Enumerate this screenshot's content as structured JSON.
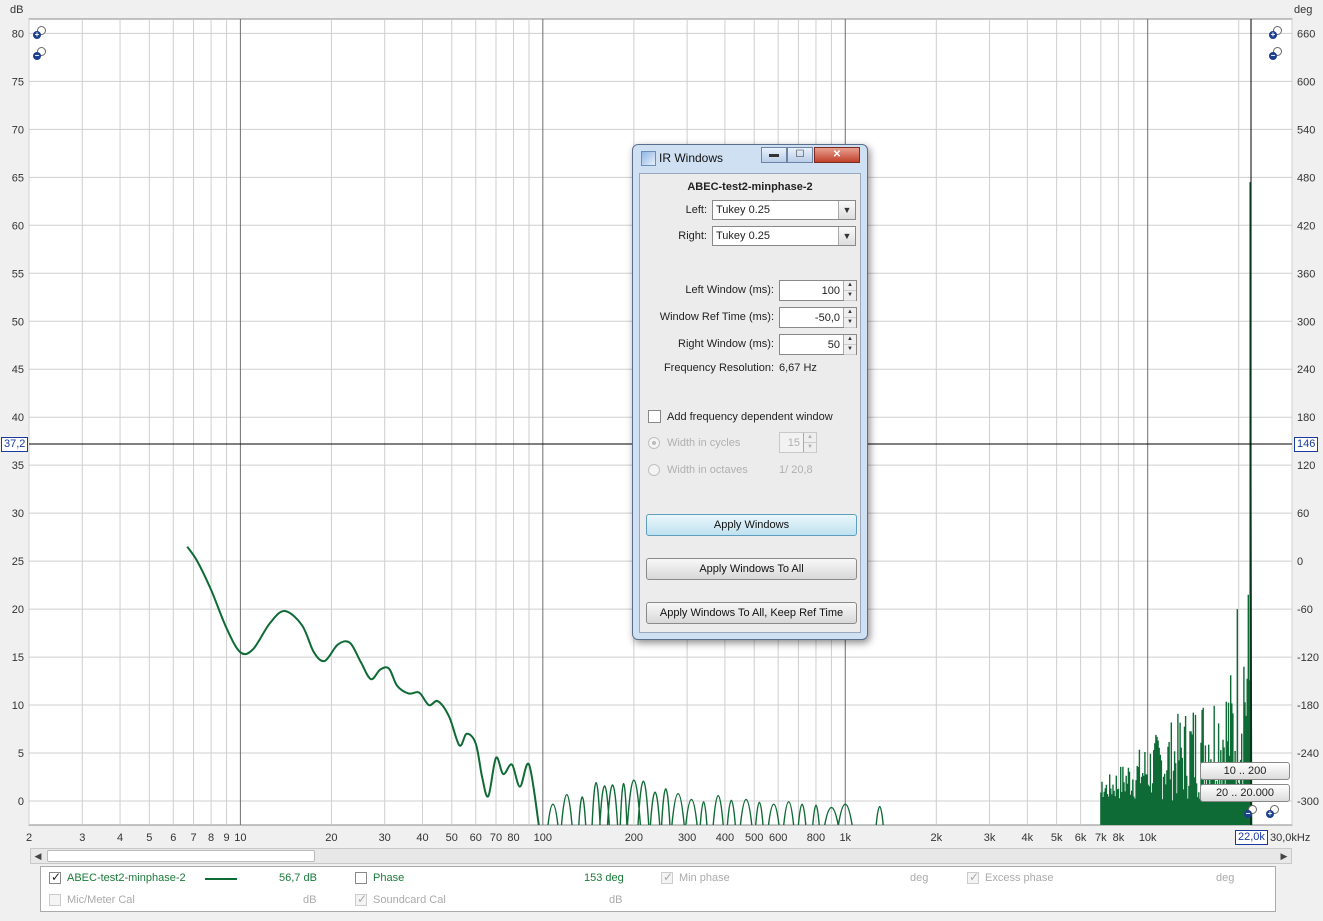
{
  "axes": {
    "left_unit": "dB",
    "right_unit": "deg",
    "left_ticks": [
      "80",
      "75",
      "70",
      "65",
      "60",
      "55",
      "50",
      "45",
      "40",
      "35",
      "30",
      "25",
      "20",
      "15",
      "10",
      "5",
      "0"
    ],
    "right_ticks": [
      "660",
      "600",
      "540",
      "480",
      "420",
      "360",
      "300",
      "240",
      "180",
      "120",
      "60",
      "0",
      "-60",
      "-120",
      "-180",
      "-240",
      "-300"
    ],
    "x_ticks": [
      "2",
      "3",
      "4",
      "5",
      "6",
      "7",
      "8",
      "9",
      "10",
      "20",
      "30",
      "40",
      "50",
      "60",
      "70",
      "80",
      "100",
      "200",
      "300",
      "400",
      "500",
      "600",
      "800",
      "1k",
      "2k",
      "3k",
      "4k",
      "5k",
      "6k",
      "7k",
      "8k",
      "10k",
      "30,0kHz"
    ]
  },
  "cursor": {
    "left_value": "37,2",
    "right_value": "146",
    "x_value": "22,0k"
  },
  "range_buttons": {
    "top": "10 .. 200",
    "bottom": "20 .. 20.000"
  },
  "chart_data": {
    "type": "line",
    "x_scale": "log",
    "xlim": [
      2,
      30000
    ],
    "ylim": [
      -2.5,
      81.5
    ],
    "ylabel": "dB",
    "y2label": "deg",
    "y2lim": [
      -330,
      678
    ],
    "grid": true,
    "series": [
      {
        "name": "ABEC-test2-minphase-2",
        "color": "#0f6b35",
        "x": [
          6.67,
          7.2,
          8,
          9,
          10,
          11,
          12.5,
          14,
          16,
          17.5,
          19,
          21,
          23,
          25,
          27,
          29,
          31,
          33,
          36,
          39,
          42,
          45,
          49,
          53,
          56,
          60,
          63,
          66,
          70,
          74,
          79,
          84,
          90,
          97
        ],
        "y": [
          26.5,
          25,
          22,
          18,
          15.5,
          15.8,
          18.5,
          19.8,
          18.3,
          15.5,
          14.6,
          16.3,
          16.5,
          14.5,
          12.7,
          13.7,
          13.8,
          12,
          11.2,
          11.3,
          10,
          10.4,
          8.8,
          5.8,
          7,
          6,
          2.5,
          0.5,
          4.5,
          2.8,
          3.8,
          1.5,
          3.8,
          -2.5
        ]
      }
    ]
  },
  "dialog": {
    "title": "IR Windows",
    "measurement": "ABEC-test2-minphase-2",
    "left_label": "Left:",
    "left_value": "Tukey 0.25",
    "right_label": "Right:",
    "right_value": "Tukey 0.25",
    "left_window_label": "Left Window (ms):",
    "left_window_value": "100",
    "ref_time_label": "Window Ref Time (ms):",
    "ref_time_value": "-50,0",
    "right_window_label": "Right Window (ms):",
    "right_window_value": "50",
    "freq_res_label": "Frequency Resolution:",
    "freq_res_value": "6,67 Hz",
    "freq_dep_label": "Add frequency dependent window",
    "width_cycles_label": "Width in cycles",
    "width_cycles_value": "15",
    "width_octaves_label": "Width in octaves",
    "width_octaves_value": "1/ 20,8",
    "apply_label": "Apply Windows",
    "apply_all_label": "Apply Windows To All",
    "apply_all_keep_label": "Apply Windows To All, Keep Ref Time"
  },
  "legend": {
    "row1": {
      "measurement_name": "ABEC-test2-minphase-2",
      "measurement_value": "56,7 dB",
      "phase_label": "Phase",
      "phase_value": "153 deg",
      "min_phase_label": "Min phase",
      "min_phase_unit": "deg",
      "excess_phase_label": "Excess phase",
      "excess_phase_unit": "deg"
    },
    "row2": {
      "mic_cal_label": "Mic/Meter Cal",
      "mic_cal_unit": "dB",
      "soundcard_cal_label": "Soundcard Cal",
      "soundcard_cal_unit": "dB"
    }
  }
}
